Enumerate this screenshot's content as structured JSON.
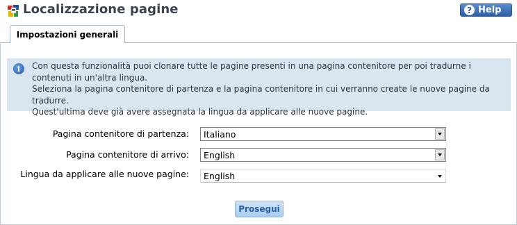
{
  "header": {
    "title": "Localizzazione pagine",
    "title_icon": "localization-icon",
    "help_label": "Help",
    "help_icon": "question-circle-icon"
  },
  "tabs": [
    {
      "label": "Impostazioni generali",
      "active": true
    }
  ],
  "info": {
    "icon": "info-icon",
    "lines": [
      "Con questa funzionalità puoi clonare tutte le pagine presenti in una pagina contenitore per poi tradurne i contenuti in un'altra lingua.",
      "Seleziona la pagina contenitore di partenza e la pagina contenitore in cui verranno create le nuove pagine da tradurre.",
      "Quest'ultima deve già avere assegnata la lingua da applicare alle nuove pagine."
    ]
  },
  "form": {
    "source_label": "Pagina contenitore di partenza:",
    "source_value": "Italiano",
    "target_label": "Pagina contenitore di arrivo:",
    "target_value": "English",
    "language_label": "Lingua da applicare alle nuove pagine:",
    "language_value": "English"
  },
  "actions": {
    "submit_label": "Prosegui"
  },
  "colors": {
    "title": "#3a4451",
    "help_button": "#2c5fa6",
    "info_background": "#d9e5ef",
    "submit_button": "#a9cdee"
  }
}
